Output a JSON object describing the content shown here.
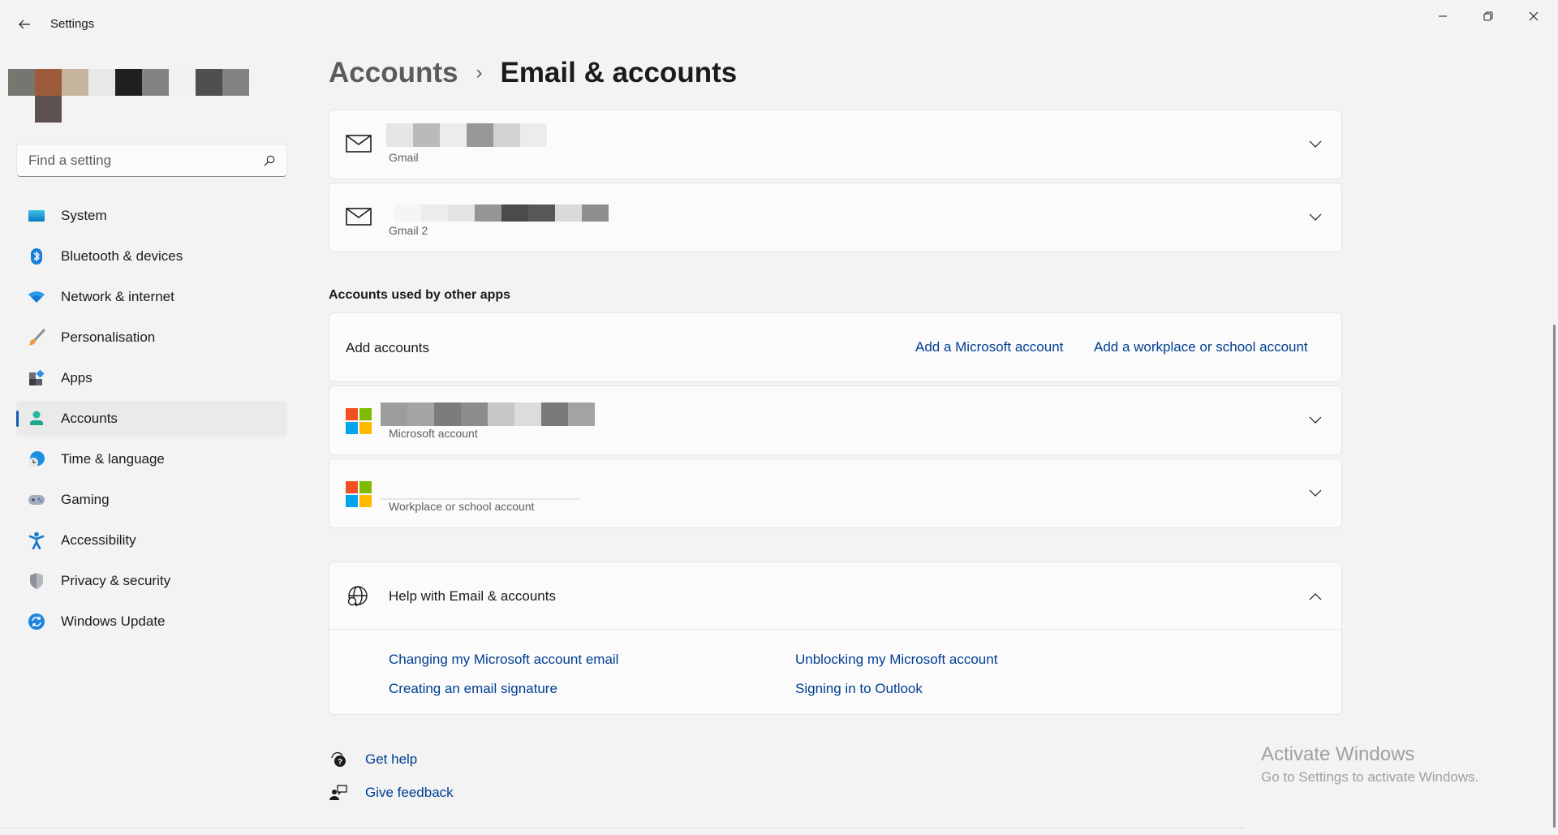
{
  "window": {
    "title": "Settings",
    "controls": {
      "minimize": "minimize-icon",
      "maximize": "restore-icon",
      "close": "close-icon"
    }
  },
  "profile": {
    "pixels_row1": [
      "#777570",
      "#9c5b3a",
      "#c7b49e",
      "#e8e8e8",
      "#1f1f1f",
      "#838383",
      "#f1f1f1",
      "#4f4f4f",
      "#828282"
    ],
    "pixels_row2": [
      "#f3f3f3",
      "#5e5151"
    ]
  },
  "search": {
    "placeholder": "Find a setting",
    "value": ""
  },
  "sidebar": {
    "items": [
      {
        "label": "System",
        "icon": "system-icon",
        "active": false
      },
      {
        "label": "Bluetooth & devices",
        "icon": "bluetooth-icon",
        "active": false
      },
      {
        "label": "Network & internet",
        "icon": "wifi-icon",
        "active": false
      },
      {
        "label": "Personalisation",
        "icon": "brush-icon",
        "active": false
      },
      {
        "label": "Apps",
        "icon": "apps-icon",
        "active": false
      },
      {
        "label": "Accounts",
        "icon": "person-icon",
        "active": true
      },
      {
        "label": "Time & language",
        "icon": "globe-clock-icon",
        "active": false
      },
      {
        "label": "Gaming",
        "icon": "gamepad-icon",
        "active": false
      },
      {
        "label": "Accessibility",
        "icon": "accessibility-icon",
        "active": false
      },
      {
        "label": "Privacy & security",
        "icon": "shield-icon",
        "active": false
      },
      {
        "label": "Windows Update",
        "icon": "update-icon",
        "active": false
      }
    ]
  },
  "breadcrumb": {
    "parent": "Accounts",
    "current": "Email & accounts"
  },
  "email_accounts": [
    {
      "type": "Gmail",
      "pixels": [
        "#e6e6e6",
        "#bababa",
        "#ececec",
        "#989898",
        "#d2d2d2",
        "#ececec"
      ]
    },
    {
      "type": "Gmail 2",
      "pixels": [
        "#f5f5f5",
        "#ececec",
        "#e4e4e4",
        "#959595",
        "#4b4b4b",
        "#575757",
        "#dadada",
        "#8e8e8e"
      ]
    }
  ],
  "other_apps": {
    "section_title": "Accounts used by other apps",
    "add_label": "Add accounts",
    "add_microsoft": "Add a Microsoft account",
    "add_workplace": "Add a workplace or school account",
    "accounts": [
      {
        "type": "Microsoft account",
        "pixels": [
          "#9d9d9d",
          "#a4a4a4",
          "#7c7c7c",
          "#8c8c8c",
          "#c7c7c7",
          "#dcdcdc",
          "#7a7a7a",
          "#a3a3a3"
        ]
      },
      {
        "type": "Workplace or school account",
        "pixels": []
      }
    ]
  },
  "help": {
    "title": "Help with Email & accounts",
    "expanded": true,
    "links": [
      "Changing my Microsoft account email",
      "Unblocking my Microsoft account",
      "Creating an email signature",
      "Signing in to Outlook"
    ]
  },
  "footer": {
    "get_help": "Get help",
    "give_feedback": "Give feedback"
  },
  "watermark": {
    "title": "Activate Windows",
    "subtitle": "Go to Settings to activate Windows."
  },
  "colors": {
    "accent": "#0f5fb4",
    "link": "#003e92",
    "background": "#f3f3f3",
    "card": "#fbfbfb"
  }
}
